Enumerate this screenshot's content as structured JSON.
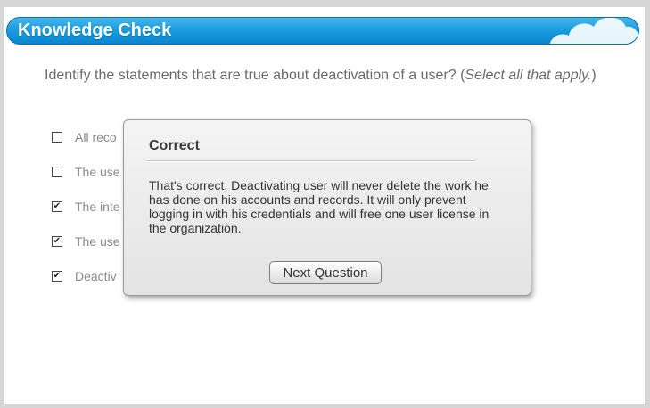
{
  "header": {
    "title": "Knowledge Check"
  },
  "question": {
    "text": "Identify the statements that are true about deactivation of a user? (",
    "hint": "Select all that apply.",
    "close": ")"
  },
  "options": [
    {
      "label": "All reco",
      "checked": false
    },
    {
      "label": "The use",
      "checked": false
    },
    {
      "label": "The inte",
      "checked": true
    },
    {
      "label": "The use",
      "checked": true
    },
    {
      "label": "Deactiv",
      "checked": true
    }
  ],
  "modal": {
    "title": "Correct",
    "message": "That's correct. Deactivating user will never delete the work he has done on his accounts and records. It will only prevent logging in with his credentials and will free one user license in the organization.",
    "next_button": "Next Question"
  },
  "colors": {
    "header_blue": "#1b9de0",
    "text_gray": "#6a6a6a"
  },
  "icons": {
    "checkbox_checked": "✔"
  }
}
